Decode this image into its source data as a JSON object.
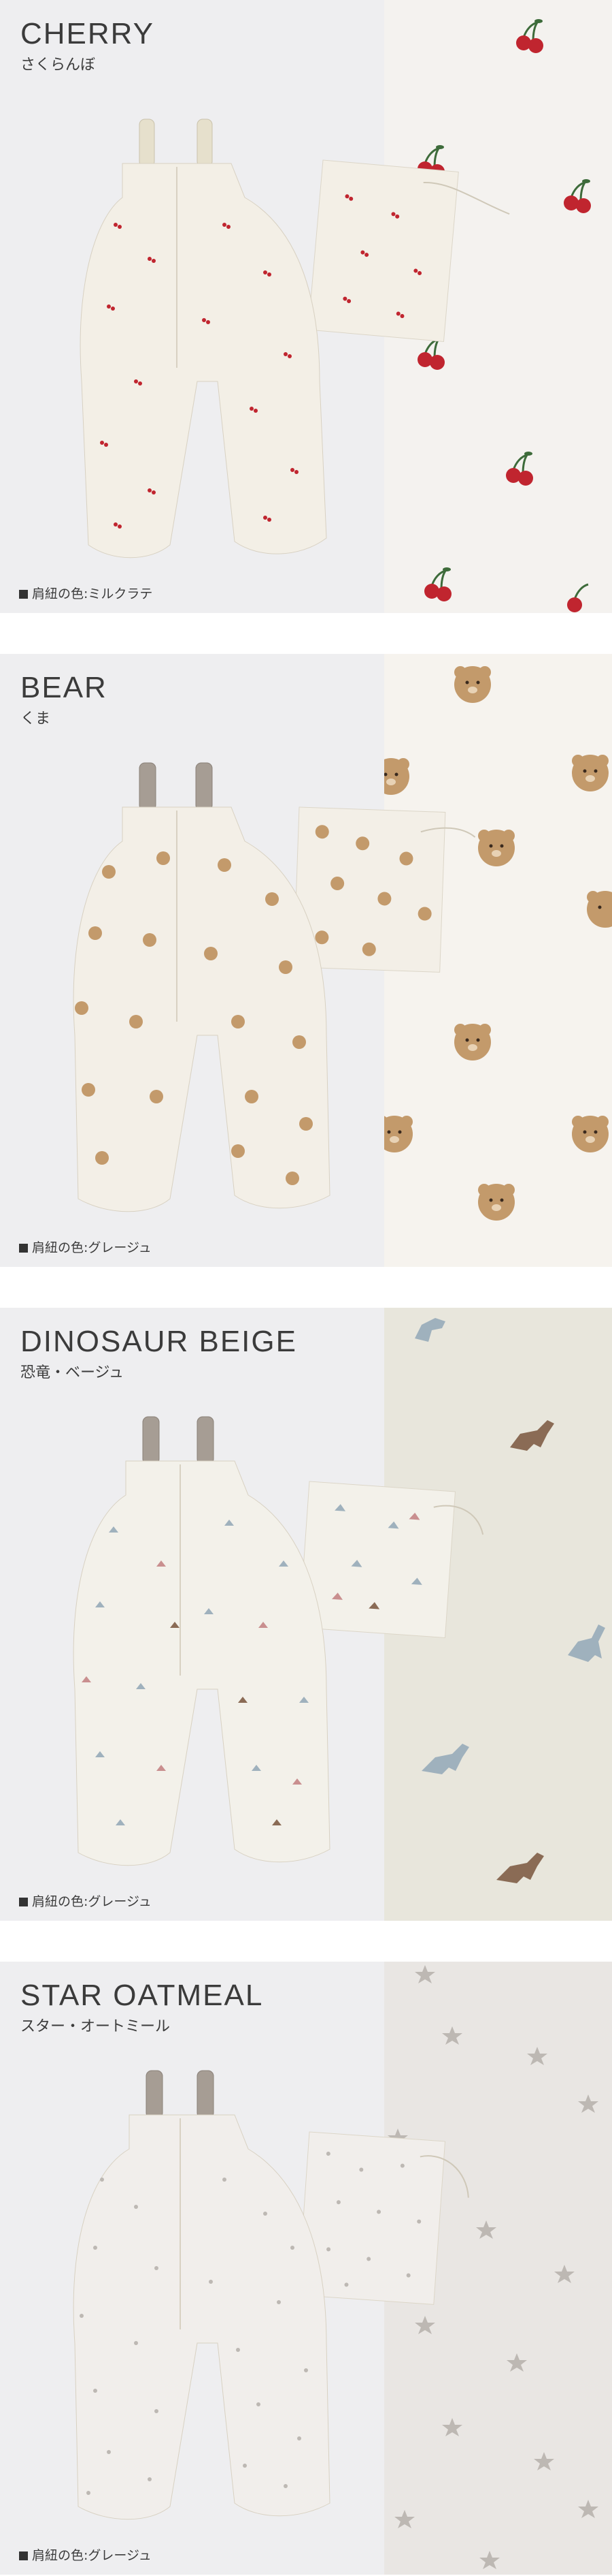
{
  "sections": [
    {
      "id": "cherry",
      "title": "CHERRY",
      "subtitle": "さくらんぼ",
      "strap_note": "肩紐の色:ミルクラテ",
      "motif_icon": "cherry-icon",
      "colors": {
        "panel": "#f4f2ef",
        "motif": "#c0252f",
        "stem": "#3d6b3a",
        "strap": "#e6e0cc",
        "fabric": "#f3efe6"
      }
    },
    {
      "id": "bear",
      "title": "BEAR",
      "subtitle": "くま",
      "strap_note": "肩紐の色:グレージュ",
      "motif_icon": "bear-face-icon",
      "colors": {
        "panel": "#f6f3ee",
        "motif": "#c39a6b",
        "stem": "#5a3d2a",
        "strap": "#a69d94",
        "fabric": "#f3efe7"
      }
    },
    {
      "id": "dinosaur-beige",
      "title": "DINOSAUR BEIGE",
      "subtitle": "恐竜・ベージュ",
      "strap_note": "肩紐の色:グレージュ",
      "motif_icon": "dinosaur-icon",
      "colors": {
        "panel": "#e8e6dc",
        "motif": "#9fb1bd",
        "stem": "#8a6b55",
        "strap": "#a69d94",
        "fabric": "#f3f1ea"
      }
    },
    {
      "id": "star-oatmeal",
      "title": "STAR OATMEAL",
      "subtitle": "スター・オートミール",
      "strap_note": "肩紐の色:グレージュ",
      "motif_icon": "star-icon",
      "colors": {
        "panel": "#e9e6e3",
        "motif": "#bdb8b3",
        "stem": "#9a938d",
        "strap": "#a69d94",
        "fabric": "#f1eeeb"
      }
    }
  ]
}
